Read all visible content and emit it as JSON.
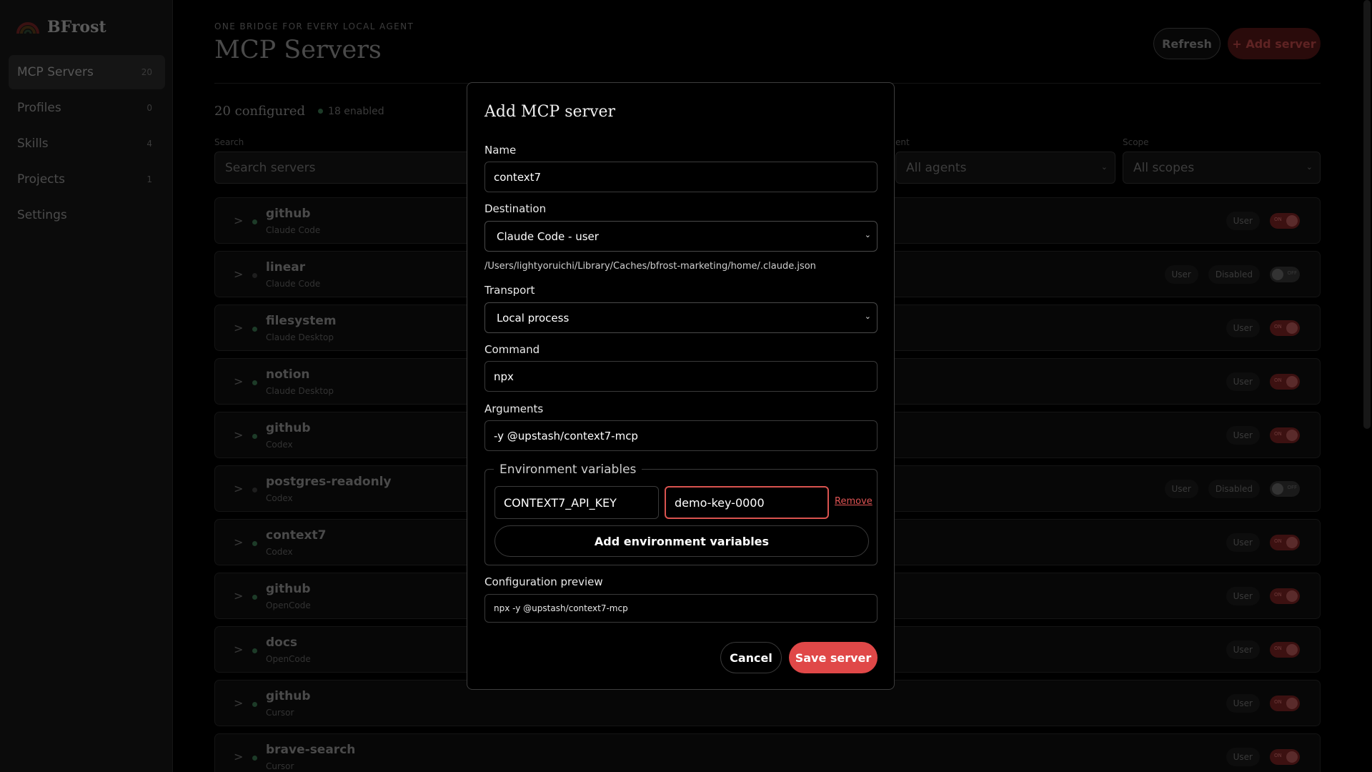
{
  "app": {
    "name": "BFrost",
    "logo_icon": "bfrost-rainbow-logo-icon"
  },
  "sidebar": {
    "items": [
      {
        "label": "MCP Servers",
        "count": "20",
        "active": true
      },
      {
        "label": "Profiles",
        "count": "0"
      },
      {
        "label": "Skills",
        "count": "4"
      },
      {
        "label": "Projects",
        "count": "1"
      },
      {
        "label": "Settings",
        "count": ""
      }
    ]
  },
  "header": {
    "eyebrow": "ONE BRIDGE FOR EVERY LOCAL AGENT",
    "title": "MCP Servers",
    "refresh_label": "Refresh",
    "add_label": "+ Add server"
  },
  "summary": {
    "configured": "20 configured",
    "enabled": "18 enabled"
  },
  "filters": {
    "search_label": "Search",
    "search_placeholder": "Search servers",
    "agent_label_partial": "ent",
    "agent_value": "All agents",
    "scope_label": "Scope",
    "scope_value": "All scopes"
  },
  "servers": [
    {
      "name": "github",
      "agent": "Claude Code",
      "scope": "User",
      "status": "",
      "toggle": "ON",
      "enabled": true
    },
    {
      "name": "linear",
      "agent": "Claude Code",
      "scope": "User",
      "status": "Disabled",
      "toggle": "OFF",
      "enabled": false
    },
    {
      "name": "filesystem",
      "agent": "Claude Desktop",
      "scope": "User",
      "status": "",
      "toggle": "ON",
      "enabled": true
    },
    {
      "name": "notion",
      "agent": "Claude Desktop",
      "scope": "User",
      "status": "",
      "toggle": "ON",
      "enabled": true
    },
    {
      "name": "github",
      "agent": "Codex",
      "scope": "User",
      "status": "",
      "toggle": "ON",
      "enabled": true
    },
    {
      "name": "postgres-readonly",
      "agent": "Codex",
      "scope": "User",
      "status": "Disabled",
      "toggle": "OFF",
      "enabled": false
    },
    {
      "name": "context7",
      "agent": "Codex",
      "scope": "User",
      "status": "",
      "toggle": "ON",
      "enabled": true
    },
    {
      "name": "github",
      "agent": "OpenCode",
      "scope": "User",
      "status": "",
      "toggle": "ON",
      "enabled": true
    },
    {
      "name": "docs",
      "agent": "OpenCode",
      "scope": "User",
      "status": "",
      "toggle": "ON",
      "enabled": true
    },
    {
      "name": "github",
      "agent": "Cursor",
      "scope": "User",
      "status": "",
      "toggle": "ON",
      "enabled": true
    },
    {
      "name": "brave-search",
      "agent": "Cursor",
      "scope": "User",
      "status": "",
      "toggle": "ON",
      "enabled": true
    }
  ],
  "modal": {
    "title": "Add MCP server",
    "name_label": "Name",
    "name_value": "context7",
    "destination_label": "Destination",
    "destination_value": "Claude Code - user",
    "destination_path": "/Users/lightyoruichi/Library/Caches/bfrost-marketing/home/.claude.json",
    "transport_label": "Transport",
    "transport_value": "Local process",
    "command_label": "Command",
    "command_value": "npx",
    "arguments_label": "Arguments",
    "arguments_value": "-y @upstash/context7-mcp",
    "env_legend": "Environment variables",
    "env_key": "CONTEXT7_API_KEY",
    "env_value": "demo-key-0000",
    "env_remove": "Remove",
    "env_add": "Add environment variables",
    "preview_label": "Configuration preview",
    "preview_value": "npx -y @upstash/context7-mcp",
    "cancel_label": "Cancel",
    "save_label": "Save server"
  },
  "colors": {
    "accent": "#e04848",
    "background": "#000000",
    "enabled_dot": "#1d3b28"
  }
}
